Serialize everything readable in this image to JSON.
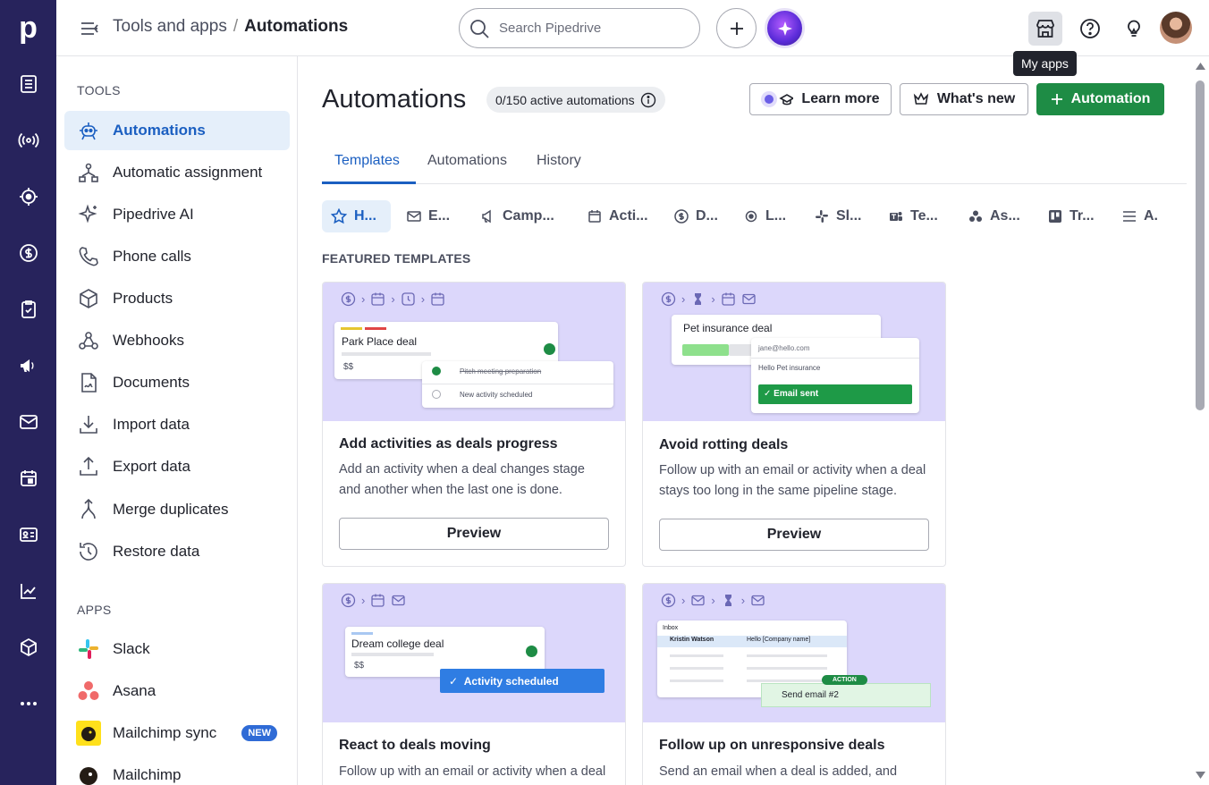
{
  "app": {
    "logo_letter": "p"
  },
  "topbar": {
    "crumb_parent": "Tools and apps",
    "crumb_sep": "/",
    "crumb_current": "Automations",
    "search_placeholder": "Search Pipedrive",
    "tooltip": "My apps"
  },
  "sidebar": {
    "tools_title": "TOOLS",
    "apps_title": "APPS",
    "tools": [
      {
        "label": "Automations"
      },
      {
        "label": "Automatic assignment"
      },
      {
        "label": "Pipedrive AI"
      },
      {
        "label": "Phone calls"
      },
      {
        "label": "Products"
      },
      {
        "label": "Webhooks"
      },
      {
        "label": "Documents"
      },
      {
        "label": "Import data"
      },
      {
        "label": "Export data"
      },
      {
        "label": "Merge duplicates"
      },
      {
        "label": "Restore data"
      }
    ],
    "apps": [
      {
        "label": "Slack"
      },
      {
        "label": "Asana"
      },
      {
        "label": "Mailchimp sync",
        "badge": "NEW"
      },
      {
        "label": "Mailchimp"
      }
    ]
  },
  "main": {
    "title": "Automations",
    "count": "0/150 active automations",
    "learn_more": "Learn more",
    "whats_new": "What's new",
    "add_automation": "Automation",
    "tabs": [
      "Templates",
      "Automations",
      "History"
    ],
    "chips": [
      "H...",
      "E...",
      "Camp...",
      "Acti...",
      "D...",
      "L...",
      "Sl...",
      "Te...",
      "As...",
      "Tr...",
      "A."
    ],
    "featured_title": "FEATURED TEMPLATES",
    "preview_label": "Preview",
    "cards": [
      {
        "title": "Add activities as deals progress",
        "desc": "Add an activity when a deal changes stage and another when the last one is done.",
        "deal": "Park Place deal",
        "amount": "$$",
        "row1": "Pitch meeting preparation",
        "row2": "New activity scheduled"
      },
      {
        "title": "Avoid rotting deals",
        "desc": "Follow up with an email or activity when a deal stays too long in the same pipeline stage.",
        "deal": "Pet insurance deal",
        "email": "jane@hello.com",
        "subject": "Hello Pet insurance",
        "sent": "Email sent"
      },
      {
        "title": "React to deals moving",
        "desc": "Follow up with an email or activity when a deal",
        "deal": "Dream college deal",
        "amount": "$$",
        "scheduled": "Activity scheduled"
      },
      {
        "title": "Follow up on unresponsive deals",
        "desc": "Send an email when a deal is added, and",
        "inbox": "Inbox",
        "sender": "Kristin Watson",
        "subject": "Hello [Company name]",
        "action": "ACTION",
        "send": "Send email #2"
      }
    ]
  },
  "colors": {
    "rail": "#27235c",
    "primary": "#1e8c45",
    "accent": "#1b5fc1",
    "illo": "#dcd7fb"
  }
}
